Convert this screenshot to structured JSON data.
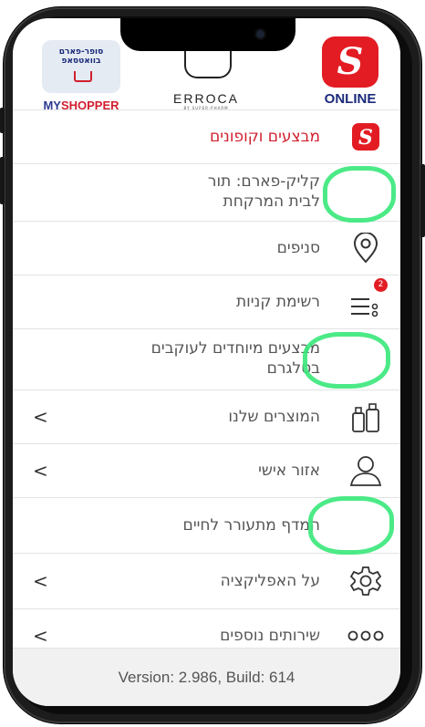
{
  "header": {
    "online_logo_text": "ONLINE",
    "erroca_text": "ERROCA",
    "erroca_sub": "BY SUPER-PHARM",
    "myshopper_hebrew_line1": "סופר-פארם",
    "myshopper_hebrew_line2": "בוואטסאפ",
    "myshopper_my": "MY",
    "myshopper_shopper": "SHOPPER"
  },
  "menu": {
    "items": [
      {
        "label": "מבצעים וקופונים",
        "icon": "super-pharm-logo-icon",
        "chevron": ""
      },
      {
        "label": "קליק-פארם: תור לבית המרקחת",
        "icon": "",
        "chevron": ""
      },
      {
        "label": "סניפים",
        "icon": "location-pin-icon",
        "chevron": ""
      },
      {
        "label": "רשימת קניות",
        "icon": "shopping-list-icon",
        "chevron": "",
        "badge": "2"
      },
      {
        "label": "מבצעים מיוחדים לעוקבים בטלגרם",
        "icon": "",
        "chevron": ""
      },
      {
        "label": "המוצרים שלנו",
        "icon": "products-bottles-icon",
        "chevron": "<"
      },
      {
        "label": "אזור אישי",
        "icon": "user-icon",
        "chevron": "<"
      },
      {
        "label": "המדף מתעורר לחיים",
        "icon": "",
        "chevron": ""
      },
      {
        "label": "על האפליקציה",
        "icon": "gear-icon",
        "chevron": "<"
      },
      {
        "label": "שירותים נוספים",
        "icon": "more-dots-icon",
        "chevron": "<"
      }
    ]
  },
  "footer": {
    "version": "Version: 2.986, Build: 614"
  },
  "colors": {
    "brand_red": "#e31c23",
    "highlight_green": "#39e87a",
    "text_gray": "#555555"
  }
}
